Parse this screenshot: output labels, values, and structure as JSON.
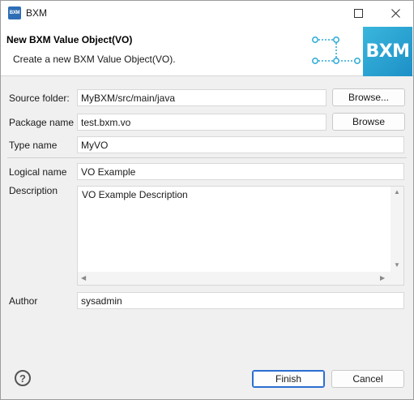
{
  "window": {
    "app_icon_text": "BXM",
    "title": "BXM",
    "icons": {
      "app": "bxm-app-icon",
      "maximize": "maximize-icon",
      "close": "close-icon",
      "help": "help-icon"
    }
  },
  "header": {
    "title": "New BXM Value Object(VO)",
    "subtitle": "Create a new BXM Value Object(VO).",
    "banner_text": "BXM",
    "accent_color": "#2aa9d6"
  },
  "form": {
    "source_folder": {
      "label": "Source folder:",
      "value": "MyBXM/src/main/java",
      "button": "Browse..."
    },
    "package_name": {
      "label": "Package name",
      "value": "test.bxm.vo",
      "button": "Browse"
    },
    "type_name": {
      "label": "Type name",
      "value": "MyVO"
    },
    "logical_name": {
      "label": "Logical name",
      "value": "VO Example"
    },
    "description": {
      "label": "Description",
      "value": "VO Example Description"
    },
    "author": {
      "label": "Author",
      "value": "sysadmin"
    }
  },
  "footer": {
    "finish": "Finish",
    "cancel": "Cancel"
  }
}
